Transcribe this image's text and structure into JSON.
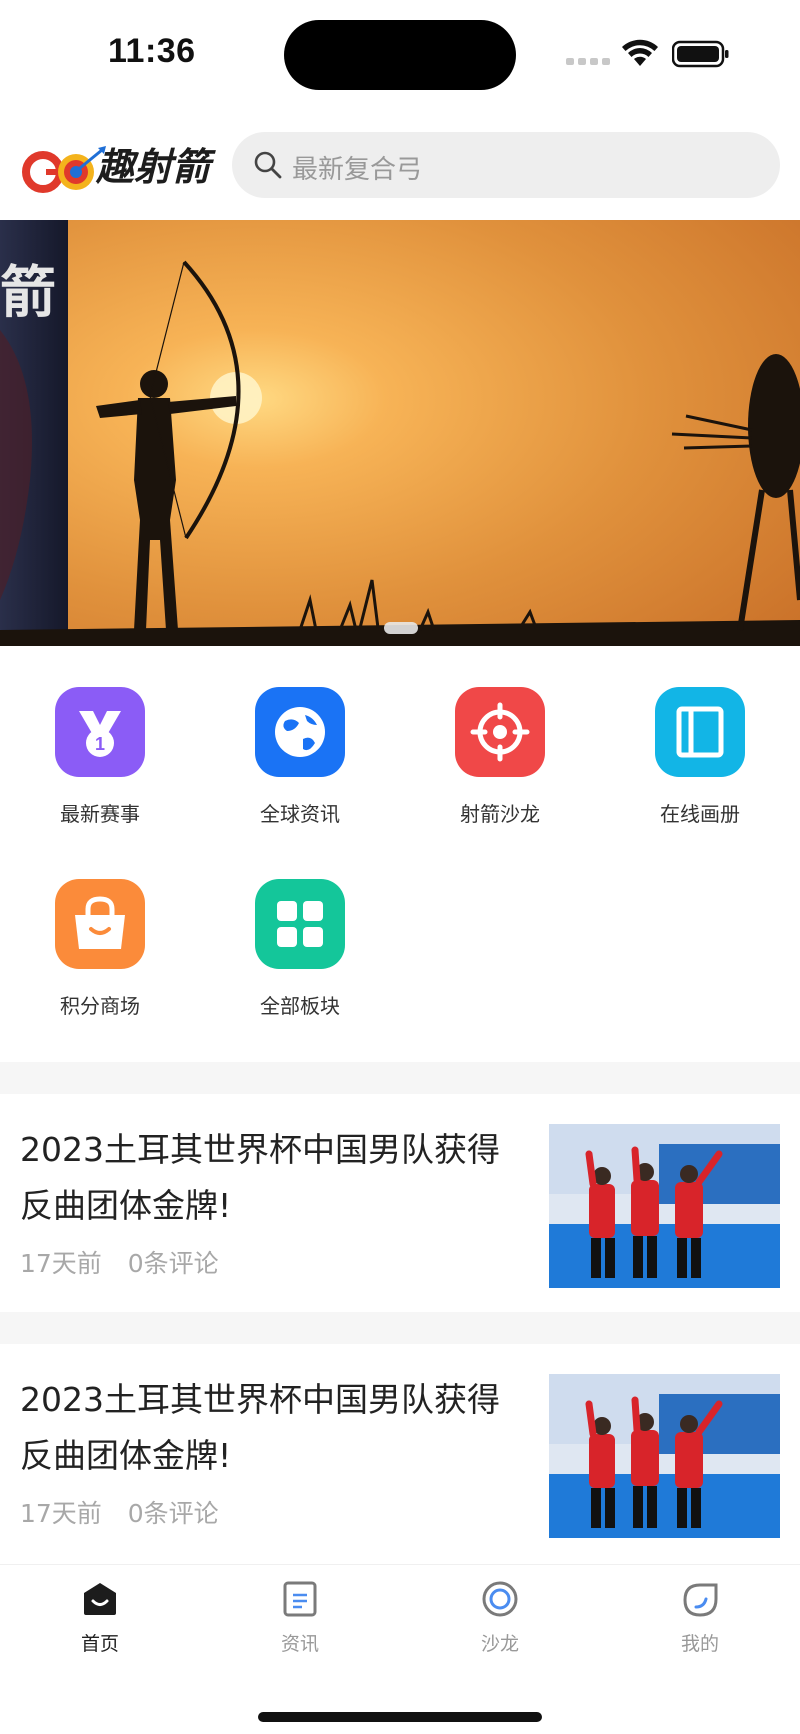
{
  "status_bar": {
    "time": "11:36"
  },
  "header": {
    "logo_text": "趣射箭",
    "search_placeholder": "最新复合弓"
  },
  "banner": {
    "side_text": "箭"
  },
  "quick_nav": [
    {
      "label": "最新赛事",
      "icon": "medal-icon",
      "color": "#8b5cf6"
    },
    {
      "label": "全球资讯",
      "icon": "globe-icon",
      "color": "#1a73f5"
    },
    {
      "label": "射箭沙龙",
      "icon": "target-icon",
      "color": "#f04848"
    },
    {
      "label": "在线画册",
      "icon": "album-icon",
      "color": "#12b5e6"
    },
    {
      "label": "积分商场",
      "icon": "shopping-bag-icon",
      "color": "#fb8b3a"
    },
    {
      "label": "全部板块",
      "icon": "grid-icon",
      "color": "#14c69a"
    }
  ],
  "news": [
    {
      "title": "2023土耳其世界杯中国男队获得反曲团体金牌!",
      "time": "17天前",
      "comments": "0条评论"
    },
    {
      "title": "2023土耳其世界杯中国男队获得反曲团体金牌!",
      "time": "17天前",
      "comments": "0条评论"
    }
  ],
  "tabbar": [
    {
      "label": "首页",
      "icon": "home-icon",
      "active": true
    },
    {
      "label": "资讯",
      "icon": "news-icon",
      "active": false
    },
    {
      "label": "沙龙",
      "icon": "salon-icon",
      "active": false
    },
    {
      "label": "我的",
      "icon": "profile-icon",
      "active": false
    }
  ]
}
